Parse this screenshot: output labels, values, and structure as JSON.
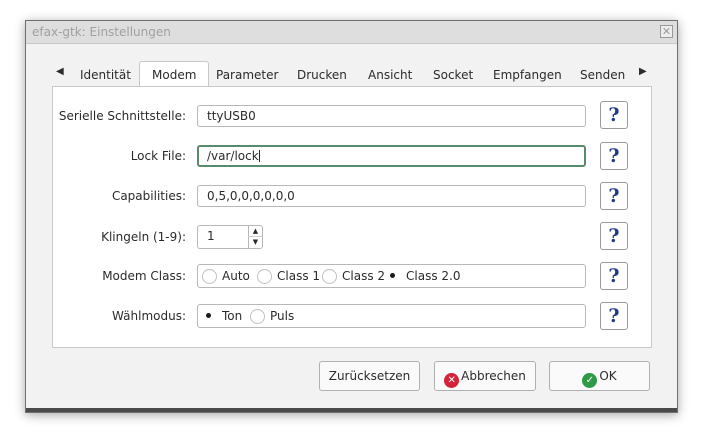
{
  "window": {
    "title": "efax-gtk: Einstellungen",
    "close_glyph": "✕"
  },
  "tabs": {
    "left_arrow": "◀",
    "right_arrow": "▶",
    "items": [
      {
        "label": "Identität"
      },
      {
        "label": "Modem"
      },
      {
        "label": "Parameter"
      },
      {
        "label": "Drucken"
      },
      {
        "label": "Ansicht"
      },
      {
        "label": "Socket"
      },
      {
        "label": "Empfangen"
      },
      {
        "label": "Senden"
      }
    ],
    "active": "Modem"
  },
  "form": {
    "serial_port": {
      "label": "Serielle Schnittstelle:",
      "value": "ttyUSB0"
    },
    "lock_file": {
      "label": "Lock File:",
      "value": "/var/lock"
    },
    "capabilities": {
      "label": "Capabilities:",
      "value": "0,5,0,0,0,0,0,0"
    },
    "rings": {
      "label": "Klingeln (1-9):",
      "value": "1"
    },
    "modem_class": {
      "label": "Modem Class:",
      "options": [
        "Auto",
        "Class 1",
        "Class 2",
        "Class 2.0"
      ],
      "selected": "Class 2.0"
    },
    "dial_mode": {
      "label": "Wählmodus:",
      "options": [
        "Ton",
        "Puls"
      ],
      "selected": "Ton"
    },
    "help_glyph": "?"
  },
  "buttons": {
    "reset": "Zurücksetzen",
    "cancel": "Abbrechen",
    "ok": "OK"
  },
  "colors": {
    "cancel_icon": "#d3243a",
    "ok_icon": "#2f9a46",
    "help_icon": "#1f3a8a",
    "focus_border": "#5a8a6e"
  }
}
